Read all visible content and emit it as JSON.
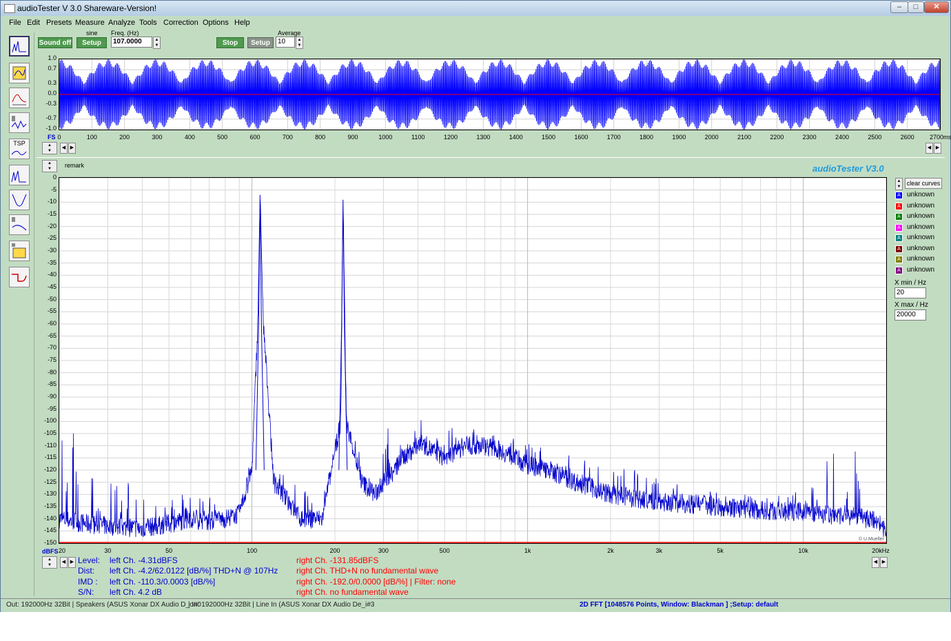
{
  "window": {
    "title": "audioTester  V 3.0 Shareware-Version!"
  },
  "menu": [
    "File",
    "Edit",
    "Presets",
    "Measure",
    "Analyze",
    "Tools",
    "Correction",
    "Options",
    "Help"
  ],
  "toolbar": {
    "sound_off": "Sound off",
    "sine_label": "sine",
    "setup1": "Setup",
    "freq_label": "Freq. (Hz)",
    "freq_value": "107.0000",
    "stop": "Stop",
    "setup2": "Setup",
    "average_label": "Average",
    "average_value": "10"
  },
  "sidebar_icons": [
    "fft-icon",
    "oscilloscope-icon",
    "frequency-response-icon",
    "speaker-impedance-icon",
    "tsp-icon",
    "spectrum-icon",
    "filter-curve-icon",
    "room-response-icon",
    "speaker-3d-icon",
    "step-response-icon"
  ],
  "sidebar_tsp_text": "TSP",
  "scope": {
    "y_ticks": [
      "1.0",
      "0.7",
      "0.3",
      "0.0",
      "-0.3",
      "-0.7",
      "-1.0"
    ],
    "x_ticks": [
      "0",
      "100",
      "200",
      "300",
      "400",
      "500",
      "600",
      "700",
      "800",
      "900",
      "1000",
      "1100",
      "1200",
      "1300",
      "1400",
      "1500",
      "1600",
      "1700",
      "1800",
      "1900",
      "2000",
      "2100",
      "2200",
      "2300",
      "2400",
      "2500",
      "2600"
    ],
    "x_end_label": "2700ms",
    "fs_label": "FS",
    "signal_color": "#0000ff",
    "zero_line_color": "#ff0000"
  },
  "fft": {
    "remark": "remark",
    "brand": "audioTester  V3.0",
    "credit": "© U.Mueller",
    "y_ticks": [
      "0",
      "-5",
      "-10",
      "-15",
      "-20",
      "-25",
      "-30",
      "-35",
      "-40",
      "-45",
      "-50",
      "-55",
      "-60",
      "-65",
      "-70",
      "-75",
      "-80",
      "-85",
      "-90",
      "-95",
      "-100",
      "-105",
      "-110",
      "-115",
      "-120",
      "-125",
      "-130",
      "-135",
      "-140",
      "-145",
      "-150"
    ],
    "y_unit": "dBFS",
    "x_ticks": [
      "20",
      "30",
      "50",
      "100",
      "200",
      "300",
      "500",
      "1k",
      "2k",
      "3k",
      "5k",
      "10k",
      "20kHz"
    ],
    "trace_color": "#0000cc",
    "floor_line_color": "#ff0000"
  },
  "chart_data": [
    {
      "type": "line",
      "title": "",
      "xlabel": "",
      "ylabel": "FS",
      "xlim": [
        0,
        2700
      ],
      "ylim": [
        -1.0,
        1.0
      ],
      "grid": true,
      "series": [
        {
          "name": "",
          "description_fundamental_hz": 107,
          "envelope_beat_period_ms": 150,
          "amplitude_min": -1.0,
          "amplitude_max": 1.0
        }
      ]
    },
    {
      "type": "line",
      "title": "",
      "xlabel": "",
      "ylabel": "dBFS",
      "x_scale": "log",
      "xlim": [
        20,
        20000
      ],
      "ylim": [
        -150,
        0
      ],
      "grid": true,
      "x": [
        20,
        25,
        30,
        40,
        50,
        60,
        70,
        80,
        90,
        100,
        105,
        107,
        110,
        120,
        150,
        180,
        210,
        214,
        220,
        250,
        280,
        300,
        330,
        350,
        400,
        430,
        450,
        500,
        600,
        700,
        800,
        1000,
        1200,
        1500,
        2000,
        2500,
        3000,
        4000,
        5000,
        6000,
        8000,
        10000,
        12000,
        13000,
        14000,
        15000,
        17000,
        18000,
        20000
      ],
      "series": [
        {
          "name": "left",
          "values": [
            -140,
            -142,
            -143,
            -144,
            -142,
            -140,
            -141,
            -140,
            -138,
            -120,
            -60,
            -7,
            -60,
            -125,
            -140,
            -140,
            -100,
            -9,
            -100,
            -125,
            -130,
            -125,
            -120,
            -115,
            -110,
            -110,
            -112,
            -115,
            -110,
            -110,
            -112,
            -118,
            -120,
            -125,
            -130,
            -132,
            -133,
            -134,
            -135,
            -136,
            -137,
            -137,
            -138,
            -139,
            -138,
            -139,
            -140,
            -140,
            -145
          ]
        },
        {
          "name": "peaks",
          "values": [
            -90,
            -118,
            -117,
            -125,
            -132,
            -128,
            -130,
            -140,
            -135,
            -104,
            -60,
            -7,
            -60,
            -120,
            -125,
            -130,
            -105,
            -9,
            -105,
            -108,
            -100,
            -105,
            -95,
            -100,
            -98,
            -102,
            -100,
            -103,
            -102,
            -104,
            -106,
            -108,
            -110,
            -115,
            -118,
            -120,
            -122,
            -125,
            -130,
            -130,
            -130,
            -128,
            -120,
            -98,
            -140,
            -102,
            -140,
            -140,
            -145
          ]
        }
      ]
    }
  ],
  "curves": {
    "clear_button": "clear curves",
    "items": [
      {
        "label": "unknown",
        "color": "#0000ff"
      },
      {
        "label": "unknown",
        "color": "#ff0000"
      },
      {
        "label": "unknown",
        "color": "#008000"
      },
      {
        "label": "unknown",
        "color": "#ff00ff"
      },
      {
        "label": "unknown",
        "color": "#008080"
      },
      {
        "label": "unknown",
        "color": "#800000"
      },
      {
        "label": "unknown",
        "color": "#808000"
      },
      {
        "label": "unknown",
        "color": "#800080"
      }
    ],
    "swatch_letter": "A",
    "xmin_label": "X min / Hz",
    "xmin_value": "20",
    "xmax_label": "X max / Hz",
    "xmax_value": "20000"
  },
  "measurements": {
    "level_label": "Level:",
    "level_left": "left Ch.  -4.31dBFS",
    "level_right": "right Ch.  -131.85dBFS",
    "dist_label": "Dist:",
    "dist_left": "left Ch.  -4.2/62.0122 [dB/%] THD+N  @ 107Hz",
    "dist_right": "right Ch. THD+N  no fundamental wave",
    "imd_label": "IMD  :",
    "imd_left": "left Ch.  -110.3/0.0003 [dB/%]",
    "imd_right": "right Ch.  -192.0/0.0000 [dB/%] |   Filter: none",
    "sn_label": "S/N:",
    "sn_left": "left Ch. 4.2 dB",
    "sn_right": "right Ch.  no fundamental wave",
    "left_color": "#0000cc",
    "right_color": "#ff0000"
  },
  "statusbar": {
    "out": "Out: 192000Hz 32Bit  | Speakers (ASUS Xonar DX Audio D_o#0",
    "in": "| In: 192000Hz 32Bit  | Line In (ASUS Xonar DX Audio De_i#3",
    "fft_info": "2D FFT [1048576 Points, Window: Blackman ]  ;Setup:  default"
  }
}
